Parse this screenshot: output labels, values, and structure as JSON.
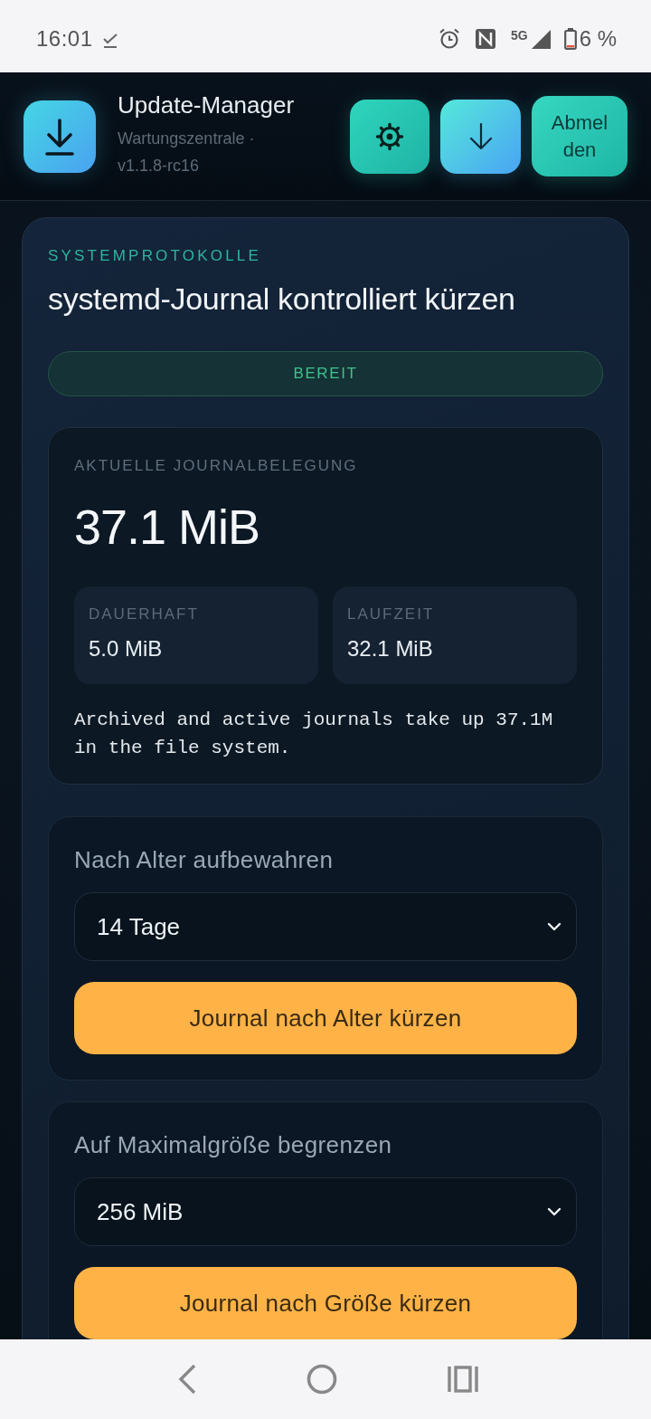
{
  "status_bar": {
    "time": "16:01",
    "network": "5G",
    "battery": "6 %"
  },
  "header": {
    "title": "Update-Manager",
    "subtitle": "Wartungszentrale · v1.1.8-rc16",
    "logout": "Abmelden"
  },
  "panel": {
    "eyebrow": "SYSTEMPROTOKOLLE",
    "title": "systemd-Journal kontrolliert kürzen",
    "status": {
      "label": "BEREIT",
      "kind": "ready"
    },
    "usage": {
      "label": "AKTUELLE JOURNALBELEGUNG",
      "value": "37.1 MiB",
      "parts": [
        {
          "label": "DAUERHAFT",
          "value": "5.0 MiB"
        },
        {
          "label": "LAUFZEIT",
          "value": "32.1 MiB"
        }
      ],
      "note": "Archived and active journals take up 37.1M in the file system."
    },
    "actions": [
      {
        "label": "Nach Alter aufbewahren",
        "value": "14 Tage",
        "button": "Journal nach Alter kürzen"
      },
      {
        "label": "Auf Maximalgröße begrenzen",
        "value": "256 MiB",
        "button": "Journal nach Größe kürzen"
      }
    ]
  }
}
